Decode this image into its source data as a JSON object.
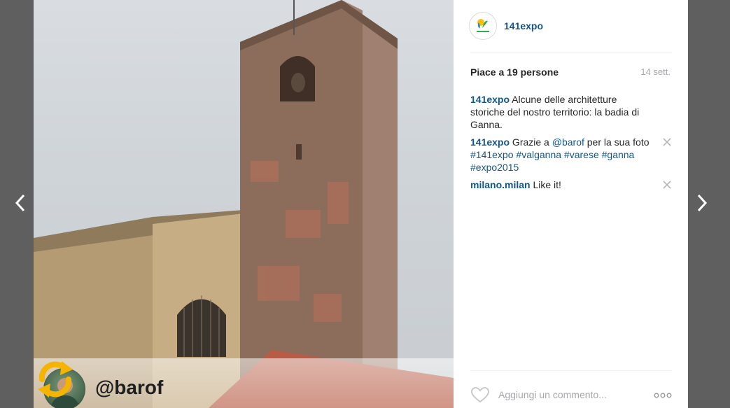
{
  "nav": {
    "prev_icon": "chevron-left-icon",
    "next_icon": "chevron-right-icon"
  },
  "photo": {
    "overlay_username": "@barof",
    "repost_icon": "repost-icon",
    "repost_color": "#f5b400"
  },
  "header": {
    "username": "141expo",
    "avatar_icon": "expo-logo-icon"
  },
  "likes": {
    "text": "Piace a 19 persone",
    "date": "14 sett."
  },
  "comments": [
    {
      "user": "141expo",
      "parts": [
        {
          "t": " Alcune delle architetture storiche del nostro territorio: la badia di Ganna."
        }
      ],
      "deletable": false
    },
    {
      "user": "141expo",
      "parts": [
        {
          "t": " Grazie a "
        },
        {
          "tag": "@barof"
        },
        {
          "t": " per la sua foto "
        },
        {
          "tag": "#141expo"
        },
        {
          "t": " "
        },
        {
          "tag": "#valganna"
        },
        {
          "t": " "
        },
        {
          "tag": "#varese"
        },
        {
          "t": " "
        },
        {
          "tag": "#ganna"
        },
        {
          "t": " "
        },
        {
          "tag": "#expo2015"
        }
      ],
      "deletable": true
    },
    {
      "user": "milano.milan",
      "parts": [
        {
          "t": " Like it!"
        }
      ],
      "deletable": true
    }
  ],
  "footer": {
    "comment_placeholder": "Aggiungi un commento...",
    "heart_icon": "heart-icon",
    "more_icon": "more-icon"
  },
  "colors": {
    "link": "#125688",
    "muted": "#a5a7aa",
    "backdrop": "#5f5f5f"
  }
}
